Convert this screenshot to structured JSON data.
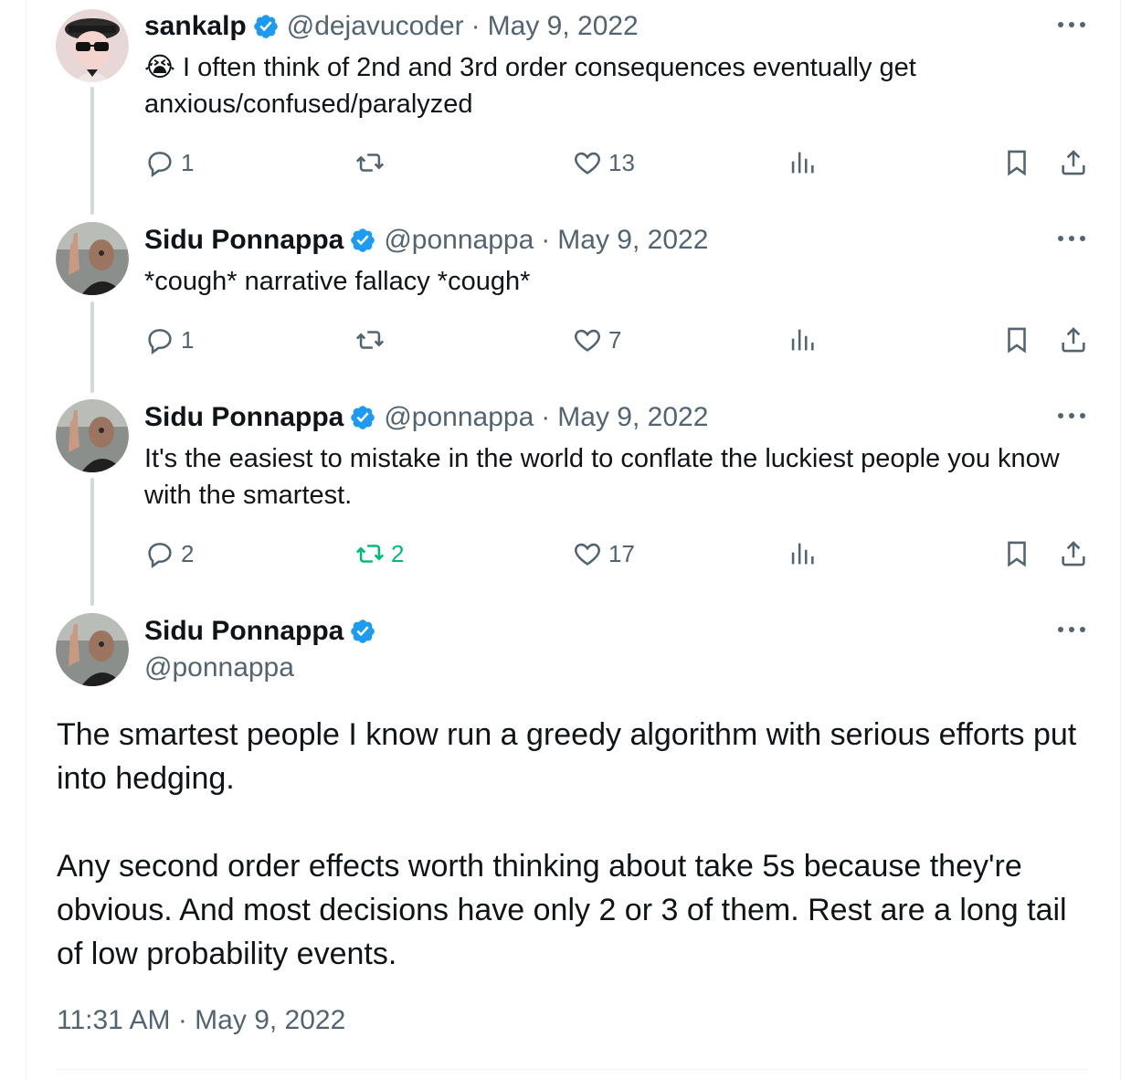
{
  "thread": [
    {
      "name": "sankalp",
      "handle": "@dejavucoder",
      "date": "May 9, 2022",
      "separator": "·",
      "emoji": "😭",
      "text": "I often think of 2nd and 3rd order consequences eventually get anxious/confused/paralyzed",
      "replies": "1",
      "retweets": "",
      "likes": "13"
    },
    {
      "name": "Sidu Ponnappa",
      "handle": "@ponnappa",
      "date": "May 9, 2022",
      "separator": "·",
      "text": "*cough* narrative fallacy *cough*",
      "replies": "1",
      "retweets": "",
      "likes": "7"
    },
    {
      "name": "Sidu Ponnappa",
      "handle": "@ponnappa",
      "date": "May 9, 2022",
      "separator": "·",
      "text": "It's the easiest to mistake in the world to conflate the luckiest people you know with the smartest.",
      "replies": "2",
      "retweets": "2",
      "likes": "17"
    }
  ],
  "main_tweet": {
    "name": "Sidu Ponnappa",
    "handle": "@ponnappa",
    "paragraph_1": "The smartest people I know run a greedy algorithm with serious efforts put into hedging.",
    "paragraph_2": "Any second order effects worth thinking about take 5s because they're obvious. And most decisions have only 2 or 3 of them. Rest are a long tail of low probability events.",
    "timestamp": "11:31 AM · May 9, 2022"
  },
  "colors": {
    "verified": "#1d9bf0",
    "secondary_text": "#536471",
    "retweet_active": "#00ba7c",
    "thread_line": "#cfd9de"
  },
  "icons": [
    "reply-icon",
    "retweet-icon",
    "like-icon",
    "views-icon",
    "bookmark-icon",
    "share-icon",
    "more-icon",
    "verified-badge-icon"
  ]
}
